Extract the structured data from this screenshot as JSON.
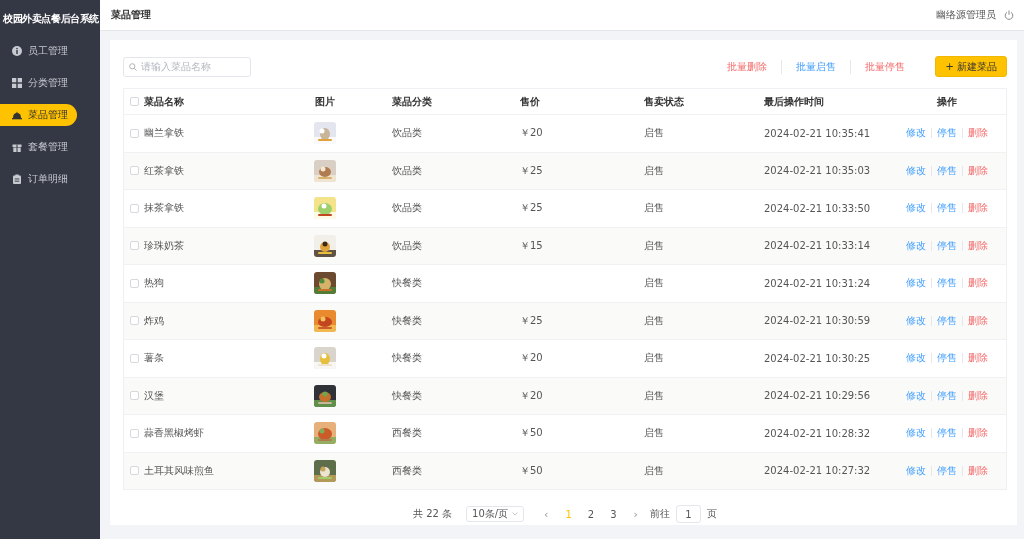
{
  "sidebar": {
    "title": "校园外卖点餐后台系统",
    "items": [
      {
        "label": "员工管理",
        "selected": false
      },
      {
        "label": "分类管理",
        "selected": false
      },
      {
        "label": "菜品管理",
        "selected": true
      },
      {
        "label": "套餐管理",
        "selected": false
      },
      {
        "label": "订单明细",
        "selected": false
      }
    ]
  },
  "header": {
    "title": "菜品管理",
    "user": "幽络源管理员"
  },
  "toolbar": {
    "search": {
      "placeholder": "请输入菜品名称"
    },
    "actions": [
      {
        "label": "批量删除",
        "kind": "danger"
      },
      {
        "label": "批量启售",
        "kind": "primary"
      },
      {
        "label": "批量停售",
        "kind": "danger"
      }
    ],
    "new_button": "+ 新建菜品"
  },
  "table": {
    "select_all": {
      "checked": false
    },
    "columns": [
      "菜品名称",
      "图片",
      "菜品分类",
      "售价",
      "售卖状态",
      "最后操作时间",
      "操作"
    ],
    "rows": [
      {
        "checked": false,
        "name": "幽兰拿铁",
        "category": "饮品类",
        "price": "￥20",
        "status": "启售",
        "time": "2024-02-21 10:35:41",
        "actions": [
          "修改",
          "停售",
          "删除"
        ]
      },
      {
        "checked": false,
        "name": "红茶拿铁",
        "category": "饮品类",
        "price": "￥25",
        "status": "启售",
        "time": "2024-02-21 10:35:03",
        "actions": [
          "修改",
          "停售",
          "删除"
        ]
      },
      {
        "checked": false,
        "name": "抹茶拿铁",
        "category": "饮品类",
        "price": "￥25",
        "status": "启售",
        "time": "2024-02-21 10:33:50",
        "actions": [
          "修改",
          "停售",
          "删除"
        ]
      },
      {
        "checked": false,
        "name": "珍珠奶茶",
        "category": "饮品类",
        "price": "￥15",
        "status": "启售",
        "time": "2024-02-21 10:33:14",
        "actions": [
          "修改",
          "停售",
          "删除"
        ]
      },
      {
        "checked": false,
        "name": "热狗",
        "category": "快餐类",
        "status": "启售",
        "time": "2024-02-21 10:31:24",
        "actions": [
          "修改",
          "停售",
          "删除"
        ]
      },
      {
        "checked": false,
        "name": "炸鸡",
        "category": "快餐类",
        "price": "￥25",
        "status": "启售",
        "time": "2024-02-21 10:30:59",
        "actions": [
          "修改",
          "停售",
          "删除"
        ]
      },
      {
        "checked": false,
        "name": "薯条",
        "category": "快餐类",
        "price": "￥20",
        "status": "启售",
        "time": "2024-02-21 10:30:25",
        "actions": [
          "修改",
          "停售",
          "删除"
        ]
      },
      {
        "checked": false,
        "name": "汉堡",
        "category": "快餐类",
        "price": "￥20",
        "status": "启售",
        "time": "2024-02-21 10:29:56",
        "actions": [
          "修改",
          "停售",
          "删除"
        ]
      },
      {
        "checked": false,
        "name": "蒜香黑椒烤虾",
        "category": "西餐类",
        "price": "￥50",
        "status": "启售",
        "time": "2024-02-21 10:28:32",
        "actions": [
          "修改",
          "停售",
          "删除"
        ]
      },
      {
        "checked": false,
        "name": "土耳其风味煎鱼",
        "category": "西餐类",
        "price": "￥50",
        "status": "启售",
        "time": "2024-02-21 10:27:32",
        "actions": [
          "修改",
          "停售",
          "删除"
        ]
      }
    ]
  },
  "pagination": {
    "total": "共 22 条",
    "page_size": "10条/页",
    "prev": "‹",
    "pages": [
      {
        "label": "1",
        "selected": true
      },
      {
        "label": "2",
        "selected": false
      },
      {
        "label": "3",
        "selected": false
      }
    ],
    "next": "›",
    "goto_label": "前往",
    "goto_value": "1",
    "goto_suffix": "页"
  }
}
